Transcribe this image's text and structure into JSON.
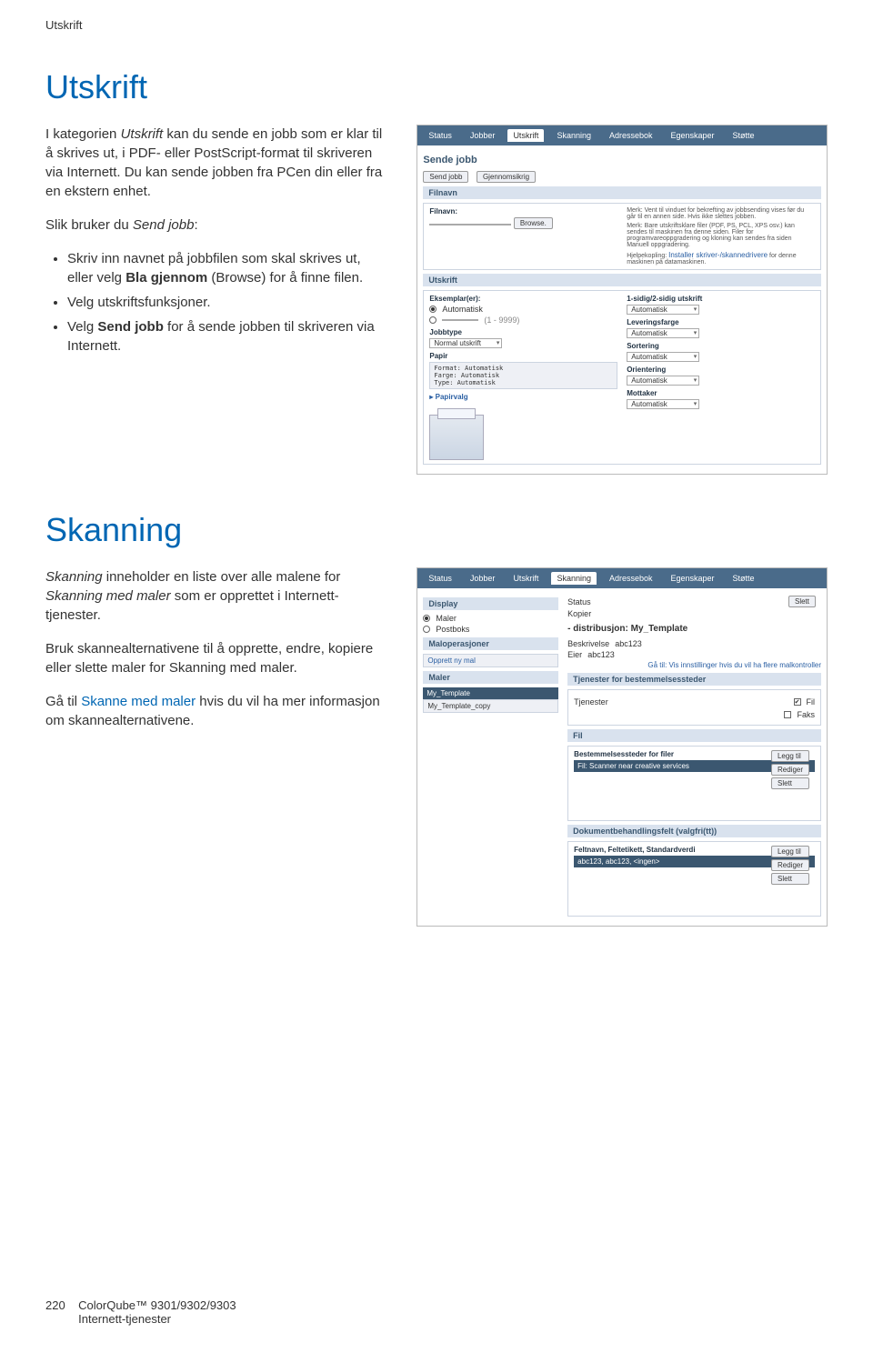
{
  "breadcrumb": "Utskrift",
  "section1": {
    "heading": "Utskrift",
    "para1_a": "I kategorien ",
    "para1_b_italic": "Utskrift",
    "para1_c": " kan du sende en jobb som er klar til å skrives ut, i PDF- eller PostScript-format til skriveren via Internett. Du kan sende jobben fra PCen din eller fra en ekstern enhet.",
    "para2_a": "Slik bruker du ",
    "para2_b_italic": "Send jobb",
    "para2_c": ":",
    "bullet1_a": "Skriv inn navnet på jobbfilen som skal skrives ut, eller velg ",
    "bullet1_b_bold": "Bla gjennom",
    "bullet1_c": " (Browse) for å finne filen.",
    "bullet2": "Velg utskriftsfunksjoner.",
    "bullet3_a": "Velg ",
    "bullet3_b_bold": "Send jobb",
    "bullet3_c": " for å sende jobben til skriveren via Internett."
  },
  "shot1": {
    "tabs": [
      "Status",
      "Jobber",
      "Utskrift",
      "Skanning",
      "Adressebok",
      "Egenskaper",
      "Støtte"
    ],
    "active_tab": "Utskrift",
    "page_title": "Sende jobb",
    "btn_send": "Send jobb",
    "btn_overview": "Gjennomsikrig",
    "sec_filnavn": "Filnavn",
    "lbl_filnavn": "Filnavn:",
    "btn_browse": "Browse.",
    "note1": "Merk: Vent til vinduet for bekrefting av jobbsending vises før du går til en annen side. Hvis ikke slettes jobben.",
    "note2": "Merk: Bare utskriftsklare filer (PDF, PS, PCL, XPS osv.) kan sendes til maskinen fra denne siden. Filer for programvareoppgradering og kloning kan sendes fra siden Manuell oppgradering.",
    "note3_a": "Hjelpekopling: ",
    "note3_b": "Installer skriver-/skannedrivere",
    "note3_c": " for denne maskinen på datamaskinen.",
    "sec_utskrift": "Utskrift",
    "lbl_eksemplarer": "Eksemplar(er):",
    "opt_auto": "Automatisk",
    "range": "(1 - 9999)",
    "lbl_jobbtype": "Jobbtype",
    "val_normal": "Normal utskrift",
    "lbl_papir": "Papir",
    "papir_lines": "Format: Automatisk\nFarge: Automatisk\nType: Automatisk",
    "lbl_papirvalg": "Papirvalg",
    "right_labels": {
      "sidig": "1-sidig/2-sidig utskrift",
      "levfarge": "Leveringsfarge",
      "sortering": "Sortering",
      "orientering": "Orientering",
      "mottaker": "Mottaker"
    },
    "val_automatisk": "Automatisk"
  },
  "section2": {
    "heading": "Skanning",
    "para1_a": "",
    "para1_b_italic": "Skanning",
    "para1_c": " inneholder en liste over alle malene for ",
    "para1_d_italic": "Skanning med maler",
    "para1_e": " som er opprettet i Internett-tjenester.",
    "para2_a": "Bruk skannealternativene til å opprette, endre, kopiere eller slette maler for Skanning med maler.",
    "para3_a": "Gå til ",
    "para3_link": "Skanne med maler",
    "para3_b": " hvis du vil ha mer informasjon om skannealternativene."
  },
  "shot2": {
    "tabs": [
      "Status",
      "Jobber",
      "Utskrift",
      "Skanning",
      "Adressebok",
      "Egenskaper",
      "Støtte"
    ],
    "active_tab": "Skanning",
    "lbl_display": "Display",
    "opt_maler": "Maler",
    "opt_postboks": "Postboks",
    "lbl_malops": "Maloperasjoner",
    "link_opprett": "Opprett ny mal",
    "lbl_maler": "Maler",
    "mal1": "My_Template",
    "mal2": "My_Template_copy",
    "lbl_status": "Status",
    "lbl_kopier": "Kopier",
    "val_slett": "Slett",
    "dist_label": "- distribusjon: My_Template",
    "beskriv_lbl": "Beskrivelse",
    "beskriv_val": "abc123",
    "eier_lbl": "Eier",
    "eier_val": "abc123",
    "link_controller": "Gå til: Vis innstillinger hvis du vil ha flere malkontroller",
    "sec_tjenester": "Tjenester for bestemmelsessteder",
    "lbl_tjenester": "Tjenester",
    "chk_fil": "Fil",
    "chk_faks": "Faks",
    "sec_fil": "Fil",
    "sec_best": "Bestemmelsessteder for filer",
    "row_fil": "Fil: Scanner near creative services",
    "btn_leggtil": "Legg til",
    "btn_rediger": "Rediger",
    "btn_slett": "Slett",
    "sec_dok": "Dokumentbehandlingsfelt (valgfri(tt))",
    "lbl_feltnavn": "Feltnavn, Feltetikett, Standardverdi",
    "row_dok": "abc123, abc123, <ingen>"
  },
  "footer": {
    "pagenum": "220",
    "product": "ColorQube™ 9301/9302/9303",
    "subtitle": "Internett-tjenester"
  }
}
